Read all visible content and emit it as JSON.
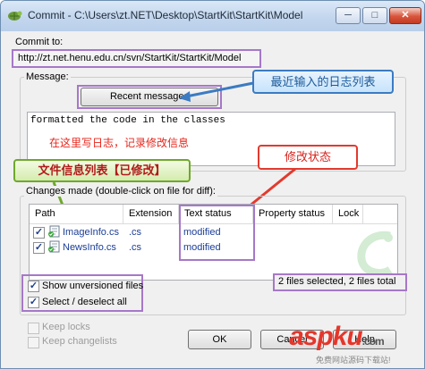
{
  "window": {
    "title": "Commit - C:\\Users\\zt.NET\\Desktop\\StartKit\\StartKit\\Model",
    "controls": {
      "minimize": "─",
      "maximize": "□",
      "close": "✕"
    }
  },
  "commit_to": {
    "label": "Commit to:",
    "url": "http://zt.net.henu.edu.cn/svn/StartKit/StartKit/Model"
  },
  "message": {
    "group_label": "Message:",
    "recent_button": "Recent messages",
    "text": "formatted the code in the classes",
    "red_note": "在这里写日志，记录修改信息"
  },
  "callouts": {
    "recent_log": "最近输入的日志列表",
    "modify_status": "修改状态",
    "file_list": "文件信息列表【已修改】"
  },
  "changes": {
    "group_label": "Changes made (double-click on file for diff):",
    "columns": [
      "Path",
      "Extension",
      "Text status",
      "Property status",
      "Lock"
    ],
    "rows": [
      {
        "checked": true,
        "path": "ImageInfo.cs",
        "extension": ".cs",
        "text_status": "modified",
        "property_status": "",
        "lock": ""
      },
      {
        "checked": true,
        "path": "NewsInfo.cs",
        "extension": ".cs",
        "text_status": "modified",
        "property_status": "",
        "lock": ""
      }
    ]
  },
  "options": {
    "show_unversioned": {
      "label": "Show unversioned files",
      "checked": true
    },
    "select_all": {
      "label": "Select / deselect all",
      "checked": true
    },
    "keep_locks": {
      "label": "Keep locks",
      "checked": false,
      "disabled": true
    },
    "keep_changelists": {
      "label": "Keep changelists",
      "checked": false,
      "disabled": true
    }
  },
  "selection_status": "2 files selected, 2 files total",
  "buttons": {
    "ok": "OK",
    "cancel": "Cancel",
    "help": "Help"
  },
  "watermark": {
    "text": "aspku",
    "suffix": ".com",
    "sub": "免费网站源码下载站!"
  },
  "colors": {
    "accent_purple": "#a678c8",
    "link_blue": "#1a3d96",
    "note_red": "#e8261c"
  }
}
